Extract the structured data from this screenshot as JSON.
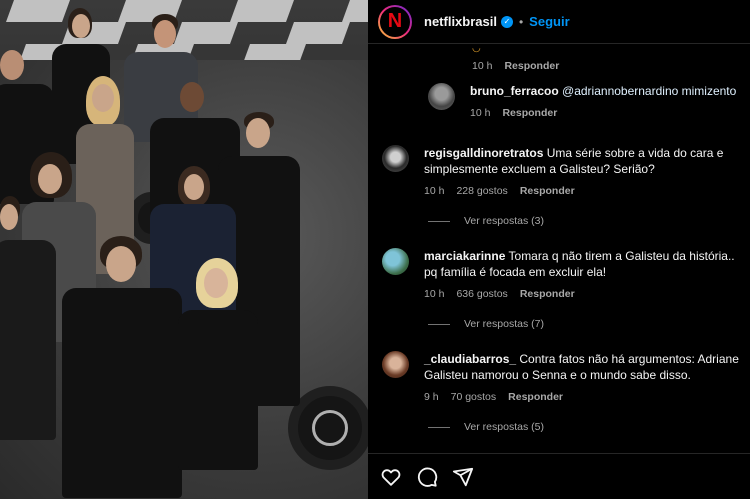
{
  "post": {
    "username": "netflixbrasil",
    "follow_label": "Seguir",
    "dot": "•",
    "brand_letter": "N"
  },
  "comments": {
    "reply_label": "Responder",
    "items": [
      {
        "id": "top-meta",
        "time": "10 h",
        "likes": "",
        "reply": "Responder"
      },
      {
        "id": "bruno",
        "user": "bruno_ferracoo",
        "text": "@adriannobernardino mimizento",
        "time": "10 h",
        "likes": "",
        "reply": "Responder"
      },
      {
        "id": "regis",
        "user": "regisgalldinoretratos",
        "text": "Uma série sobre a vida do cara e simplesmente excluem a Galisteu? Serião?",
        "time": "10 h",
        "likes": "228 gostos",
        "reply": "Responder",
        "view_replies": "Ver respostas (3)"
      },
      {
        "id": "marcia",
        "user": "marciakarinne",
        "text": "Tomara q não tirem a Galisteu da história.. pq família é focada em excluir ela!",
        "time": "10 h",
        "likes": "636 gostos",
        "reply": "Responder",
        "view_replies": "Ver respostas (7)"
      },
      {
        "id": "claudia",
        "user": "_claudiabarros_",
        "text": "Contra fatos não há argumentos: Adriane Galisteu namorou o Senna e o mundo sabe disso.",
        "time": "9 h",
        "likes": "70 gostos",
        "reply": "Responder",
        "view_replies": "Ver respostas (5)"
      }
    ]
  },
  "icons": {
    "like": "heart-icon",
    "comment": "comment-icon",
    "share": "share-icon",
    "verified": "verified-badge-icon"
  },
  "colors": {
    "background": "#000000",
    "accent_blue": "#0095f6",
    "brand_red": "#e50914",
    "muted": "#a8a8a8"
  }
}
